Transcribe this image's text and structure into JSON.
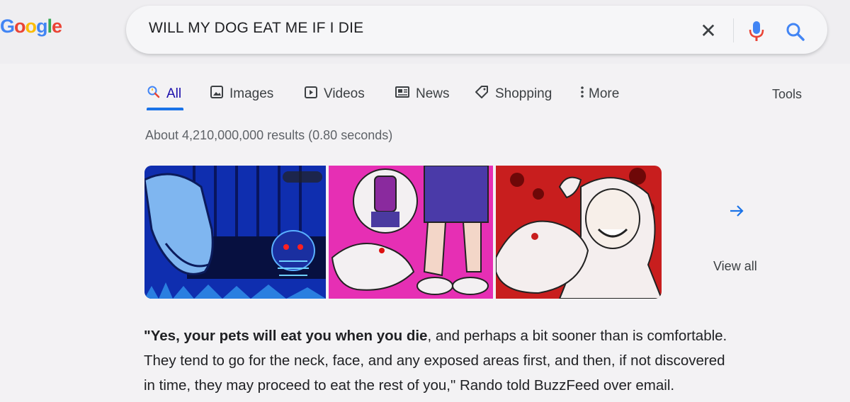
{
  "logo": {
    "letters": [
      "G",
      "o",
      "o",
      "g",
      "l",
      "e"
    ],
    "colors": [
      "#4285f4",
      "#ea4335",
      "#fbbc05",
      "#4285f4",
      "#34a853",
      "#ea4335"
    ]
  },
  "search": {
    "query": "WILL MY DOG EAT ME IF I DIE",
    "clear_icon": "close-icon",
    "mic_icon": "mic-icon",
    "search_icon": "search-icon"
  },
  "tabs": [
    {
      "label": "All",
      "icon": "search-icon",
      "active": true
    },
    {
      "label": "Images",
      "icon": "image-icon",
      "active": false
    },
    {
      "label": "Videos",
      "icon": "video-icon",
      "active": false
    },
    {
      "label": "News",
      "icon": "news-icon",
      "active": false
    },
    {
      "label": "Shopping",
      "icon": "tag-icon",
      "active": false
    },
    {
      "label": "More",
      "icon": "more-vert-icon",
      "active": false
    }
  ],
  "tools_label": "Tools",
  "result_stats": "About 4,210,000,000 results (0.80 seconds)",
  "image_strip": {
    "view_all_label": "View all",
    "arrow_icon": "arrow-right-icon"
  },
  "snippet": {
    "bold": "\"Yes, your pets will eat you when you die",
    "rest_line1": ", and perhaps a bit sooner than is comfortable.",
    "line2": "They tend to go for the neck, face, and any exposed areas first, and then, if not discovered",
    "line3": "in time, they may proceed to eat the rest of you,\" Rando told BuzzFeed over email."
  },
  "colors": {
    "accent": "#1a73e8",
    "link": "#1a0dab",
    "mic_red": "#ea4335"
  }
}
